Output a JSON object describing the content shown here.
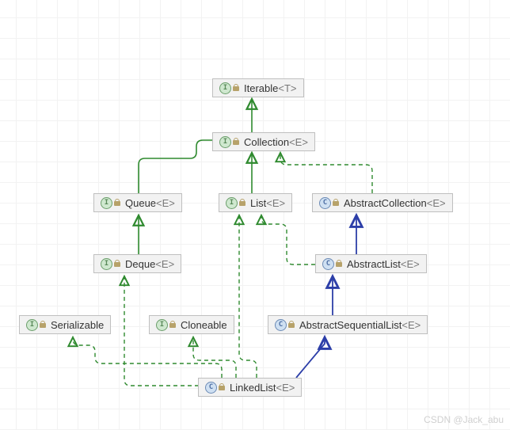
{
  "watermark": "CSDN @Jack_abu",
  "colors": {
    "extends": "#2f8a2f",
    "implements_dashed": "#2f8a2f",
    "class_extends": "#2c3ea8",
    "node_bg": "#f2f2f2",
    "node_border": "#bfbfbf"
  },
  "legend": {
    "interface_icon": "I (green circle) = interface",
    "class_icon": "C (blue circle) = class",
    "lock_icon": "locked / library type",
    "solid_green": "interface extends interface",
    "dashed_green": "class implements interface",
    "solid_blue": "class extends class"
  },
  "nodes": {
    "iterable": {
      "kind": "interface",
      "name": "Iterable",
      "tp": "<T>"
    },
    "collection": {
      "kind": "interface",
      "name": "Collection",
      "tp": "<E>"
    },
    "queue": {
      "kind": "interface",
      "name": "Queue",
      "tp": "<E>"
    },
    "list": {
      "kind": "interface",
      "name": "List",
      "tp": "<E>"
    },
    "abstractCollection": {
      "kind": "class",
      "name": "AbstractCollection",
      "tp": "<E>"
    },
    "deque": {
      "kind": "interface",
      "name": "Deque",
      "tp": "<E>"
    },
    "abstractList": {
      "kind": "class",
      "name": "AbstractList",
      "tp": "<E>"
    },
    "serializable": {
      "kind": "interface",
      "name": "Serializable",
      "tp": ""
    },
    "cloneable": {
      "kind": "interface",
      "name": "Cloneable",
      "tp": ""
    },
    "abstractSequentialList": {
      "kind": "class",
      "name": "AbstractSequentialList",
      "tp": "<E>"
    },
    "linkedList": {
      "kind": "class",
      "name": "LinkedList",
      "tp": "<E>"
    }
  },
  "edges": [
    {
      "from": "collection",
      "to": "iterable",
      "style": "solid-green",
      "relation": "extends"
    },
    {
      "from": "queue",
      "to": "collection",
      "style": "solid-green",
      "relation": "extends"
    },
    {
      "from": "list",
      "to": "collection",
      "style": "solid-green",
      "relation": "extends"
    },
    {
      "from": "abstractCollection",
      "to": "collection",
      "style": "dashed-green",
      "relation": "implements"
    },
    {
      "from": "deque",
      "to": "queue",
      "style": "solid-green",
      "relation": "extends"
    },
    {
      "from": "abstractList",
      "to": "abstractCollection",
      "style": "solid-blue",
      "relation": "extends"
    },
    {
      "from": "abstractList",
      "to": "list",
      "style": "dashed-green",
      "relation": "implements"
    },
    {
      "from": "abstractSequentialList",
      "to": "abstractList",
      "style": "solid-blue",
      "relation": "extends"
    },
    {
      "from": "linkedList",
      "to": "abstractSequentialList",
      "style": "solid-blue",
      "relation": "extends"
    },
    {
      "from": "linkedList",
      "to": "cloneable",
      "style": "dashed-green",
      "relation": "implements"
    },
    {
      "from": "linkedList",
      "to": "list",
      "style": "dashed-green",
      "relation": "implements"
    },
    {
      "from": "linkedList",
      "to": "serializable",
      "style": "dashed-green",
      "relation": "implements"
    },
    {
      "from": "linkedList",
      "to": "deque",
      "style": "dashed-green",
      "relation": "implements"
    }
  ]
}
